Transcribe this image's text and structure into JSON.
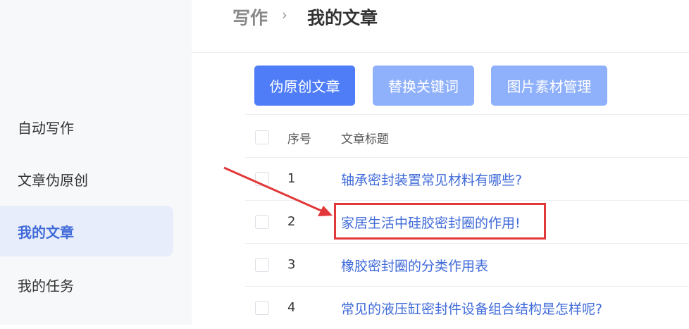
{
  "sidebar": {
    "items": [
      {
        "label": "自动写作"
      },
      {
        "label": "文章伪原创"
      },
      {
        "label": "我的文章",
        "active": true
      },
      {
        "label": "我的任务"
      }
    ]
  },
  "breadcrumb": {
    "parent": "写作",
    "separator": "›",
    "current": "我的文章"
  },
  "toolbar": {
    "pseudo_original": "伪原创文章",
    "replace_keywords": "替换关键词",
    "image_assets": "图片素材管理"
  },
  "table": {
    "headers": {
      "index": "序号",
      "title": "文章标题"
    },
    "rows": [
      {
        "index": "1",
        "title": "轴承密封装置常见材料有哪些?"
      },
      {
        "index": "2",
        "title": "家居生活中硅胶密封圈的作用!"
      },
      {
        "index": "3",
        "title": "橡胶密封圈的分类作用表"
      },
      {
        "index": "4",
        "title": "常见的液压缸密封件设备组合结构是怎样呢?"
      }
    ]
  },
  "colors": {
    "accent": "#4e7df7",
    "accent_light": "#8fb0fa",
    "link": "#3f6ad8",
    "annotation": "#e2383a"
  }
}
